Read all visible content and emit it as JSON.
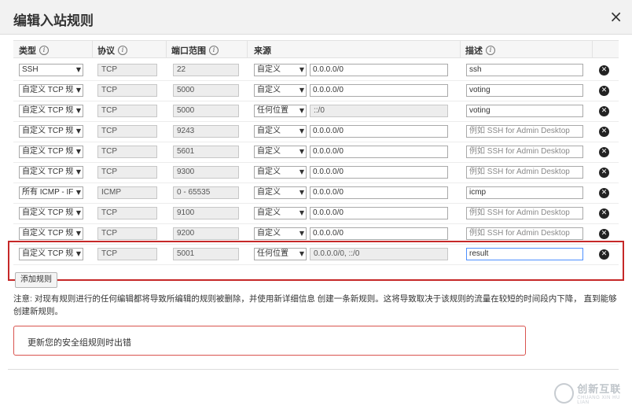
{
  "dialog": {
    "title": "编辑入站规则",
    "close_glyph": "×"
  },
  "columns": {
    "type": "类型",
    "protocol": "协议",
    "port": "端口范围",
    "source": "来源",
    "desc": "描述",
    "info_glyph": "i"
  },
  "rows": [
    {
      "type": "SSH",
      "protocol": "TCP",
      "port": "22",
      "source": "自定义",
      "cidr": "0.0.0.0/0",
      "desc": "ssh",
      "desc_placeholder": false
    },
    {
      "type": "自定义 TCP 规",
      "protocol": "TCP",
      "port": "5000",
      "source": "自定义",
      "cidr": "0.0.0.0/0",
      "desc": "voting",
      "desc_placeholder": false
    },
    {
      "type": "自定义 TCP 规",
      "protocol": "TCP",
      "port": "5000",
      "source": "任何位置",
      "cidr": "::/0",
      "desc": "voting",
      "desc_placeholder": false
    },
    {
      "type": "自定义 TCP 规",
      "protocol": "TCP",
      "port": "9243",
      "source": "自定义",
      "cidr": "0.0.0.0/0",
      "desc": "例如 SSH for Admin Desktop",
      "desc_placeholder": true
    },
    {
      "type": "自定义 TCP 规",
      "protocol": "TCP",
      "port": "5601",
      "source": "自定义",
      "cidr": "0.0.0.0/0",
      "desc": "例如 SSH for Admin Desktop",
      "desc_placeholder": true
    },
    {
      "type": "自定义 TCP 规",
      "protocol": "TCP",
      "port": "9300",
      "source": "自定义",
      "cidr": "0.0.0.0/0",
      "desc": "例如 SSH for Admin Desktop",
      "desc_placeholder": true
    },
    {
      "type": "所有 ICMP - IF",
      "protocol": "ICMP",
      "port": "0 - 65535",
      "source": "自定义",
      "cidr": "0.0.0.0/0",
      "desc": "icmp",
      "desc_placeholder": false
    },
    {
      "type": "自定义 TCP 规",
      "protocol": "TCP",
      "port": "9100",
      "source": "自定义",
      "cidr": "0.0.0.0/0",
      "desc": "例如 SSH for Admin Desktop",
      "desc_placeholder": true
    },
    {
      "type": "自定义 TCP 规",
      "protocol": "TCP",
      "port": "9200",
      "source": "自定义",
      "cidr": "0.0.0.0/0",
      "desc": "例如 SSH for Admin Desktop",
      "desc_placeholder": true
    },
    {
      "type": "自定义 TCP 规",
      "protocol": "TCP",
      "port": "5001",
      "source": "任何位置",
      "cidr": "0.0.0.0/0, ::/0",
      "desc": "result",
      "desc_placeholder": false,
      "highlighted": true
    }
  ],
  "delete_glyph": "✕",
  "dropdown_glyph": "▼",
  "add_rule_label": "添加规则",
  "note": "注意: 对现有规则进行的任何编辑都将导致所编辑的规则被删除，并使用新详细信息 创建一条新规则。这将导致取决于该规则的流量在较短的时间段内下降， 直到能够创建新规则。",
  "error_message": "更新您的安全组规则时出错",
  "watermark": {
    "name": "创新互联",
    "sub": "CHUANG XIN HU LIAN"
  },
  "colors": {
    "highlight_border": "#c62828",
    "error_border": "#d9534f",
    "focus_border": "#4d90fe"
  }
}
